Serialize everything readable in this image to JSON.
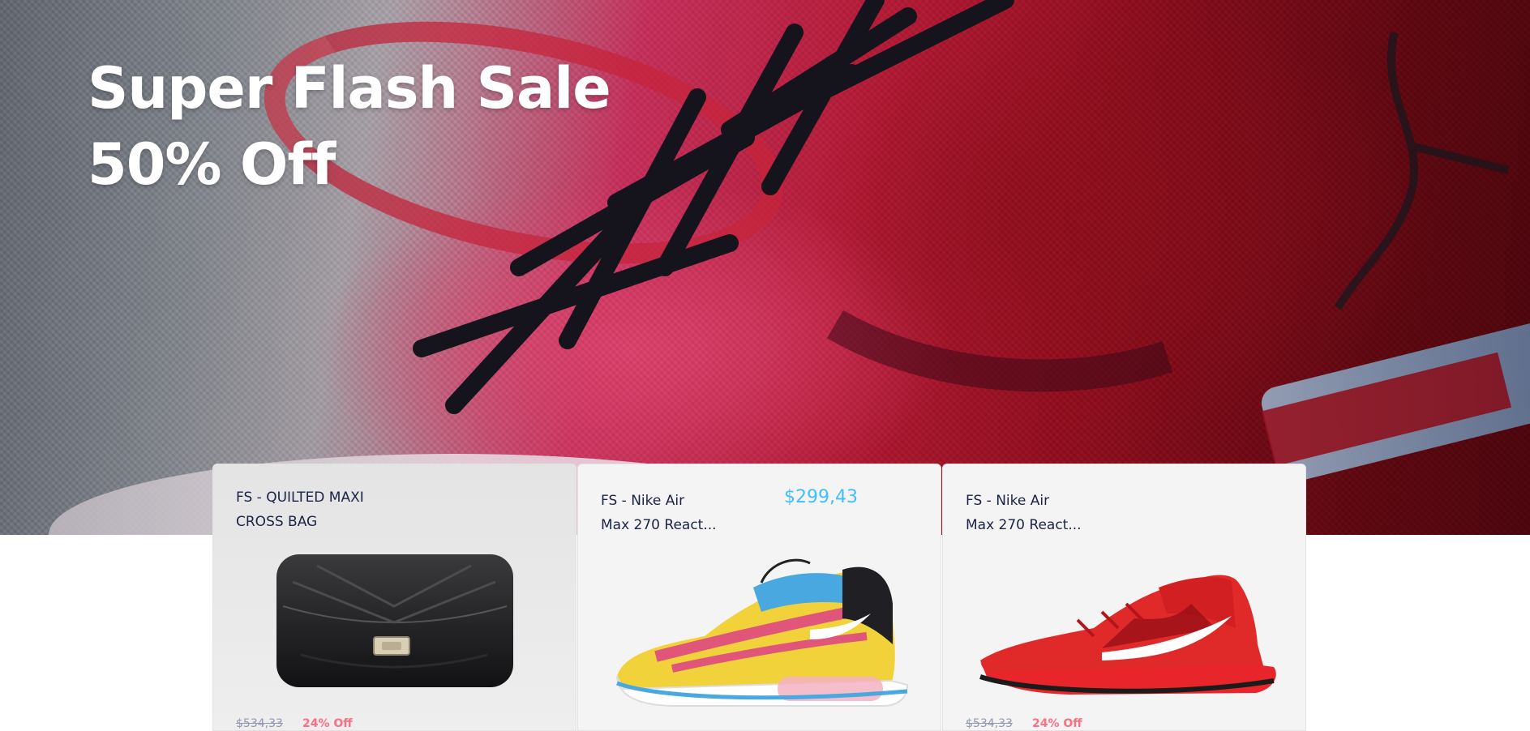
{
  "hero": {
    "title_line1": "Super Flash Sale",
    "title_line2": "50% Off",
    "image": "red-sneaker-closeup"
  },
  "products": [
    {
      "name_line1": "FS - QUILTED MAXI",
      "name_line2": "CROSS BAG",
      "price": "",
      "old_price": "$534,33",
      "discount": "24% Off",
      "image": "black-quilted-bag"
    },
    {
      "name_line1": "FS - Nike Air",
      "name_line2": "Max 270 React...",
      "price": "$299,43",
      "old_price": "",
      "discount": "",
      "image": "colorful-sneaker"
    },
    {
      "name_line1": "FS - Nike Air",
      "name_line2": "Max 270 React...",
      "price": "",
      "old_price": "$534,33",
      "discount": "24% Off",
      "image": "red-sneaker"
    }
  ],
  "colors": {
    "accent": "#40bfff",
    "text_dark": "#1b2347",
    "discount": "#fb7181",
    "muted": "#9098b1"
  }
}
